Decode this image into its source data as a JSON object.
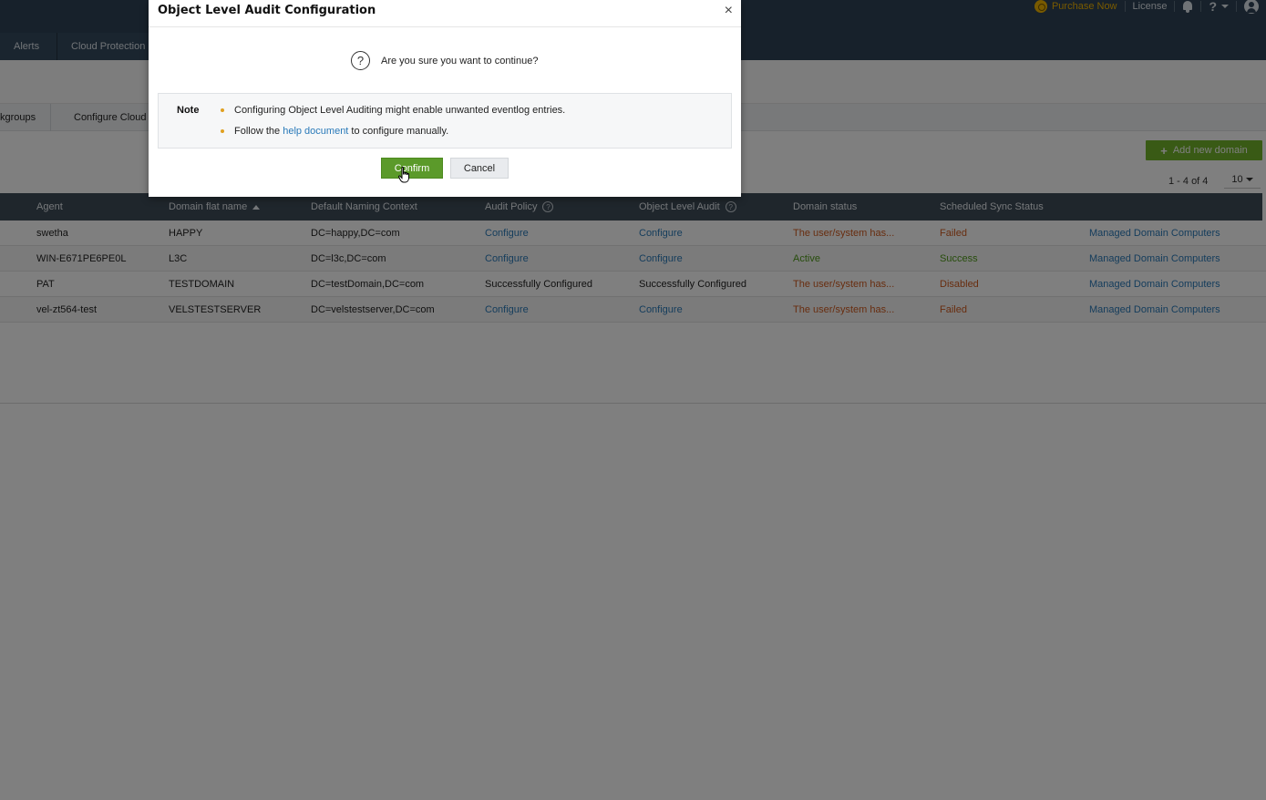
{
  "topbar": {
    "purchase_label": "Purchase Now",
    "license_label": "License",
    "help_label": "?"
  },
  "nav": {
    "tabs": [
      {
        "label": "Alerts"
      },
      {
        "label": "Cloud Protection"
      }
    ]
  },
  "subnav": {
    "items": [
      {
        "label": "kgroups"
      },
      {
        "label": "Configure Cloud"
      }
    ]
  },
  "toolbar": {
    "add_domain_label": "Add new domain",
    "pager_text": "1 - 4 of 4",
    "page_size": "10"
  },
  "table": {
    "headers": {
      "agent": "Agent",
      "domain_flat_name": "Domain flat name",
      "default_naming_context": "Default Naming Context",
      "audit_policy": "Audit Policy",
      "object_level_audit": "Object Level Audit",
      "domain_status": "Domain status",
      "scheduled_sync_status": "Scheduled Sync Status"
    },
    "rows": [
      {
        "agent": "swetha",
        "flat": "HAPPY",
        "context": "DC=happy,DC=com",
        "audit": "Configure",
        "ola": "Configure",
        "status": "The user/system has...",
        "sync": "Failed",
        "link": "Managed Domain Computers"
      },
      {
        "agent": "WIN-E671PE6PE0L",
        "flat": "L3C",
        "context": "DC=l3c,DC=com",
        "audit": "Configure",
        "ola": "Configure",
        "status": "Active",
        "sync": "Success",
        "link": "Managed Domain Computers"
      },
      {
        "agent": "PAT",
        "flat": "TESTDOMAIN",
        "context": "DC=testDomain,DC=com",
        "audit": "Successfully Configured",
        "ola": "Successfully Configured",
        "status": "The user/system has...",
        "sync": "Disabled",
        "link": "Managed Domain Computers"
      },
      {
        "agent": "vel-zt564-test",
        "flat": "VELSTESTSERVER",
        "context": "DC=velstestserver,DC=com",
        "audit": "Configure",
        "ola": "Configure",
        "status": "The user/system has...",
        "sync": "Failed",
        "link": "Managed Domain Computers"
      }
    ]
  },
  "modal": {
    "title": "Object Level Audit Configuration",
    "close_glyph": "×",
    "question": "Are you sure you want to continue?",
    "note_label": "Note",
    "note_1": "Configuring Object Level Auditing might enable unwanted eventlog entries.",
    "note_2_prefix": "Follow the ",
    "note_2_link": "help document",
    "note_2_suffix": " to configure manually.",
    "confirm_label": "Confirm",
    "cancel_label": "Cancel"
  },
  "colors": {
    "header_bg": "#2f4256",
    "accent_green": "#5b9a2a",
    "link_blue": "#2a7ab9",
    "status_red": "#d05a1e",
    "status_green": "#4f9a18"
  }
}
